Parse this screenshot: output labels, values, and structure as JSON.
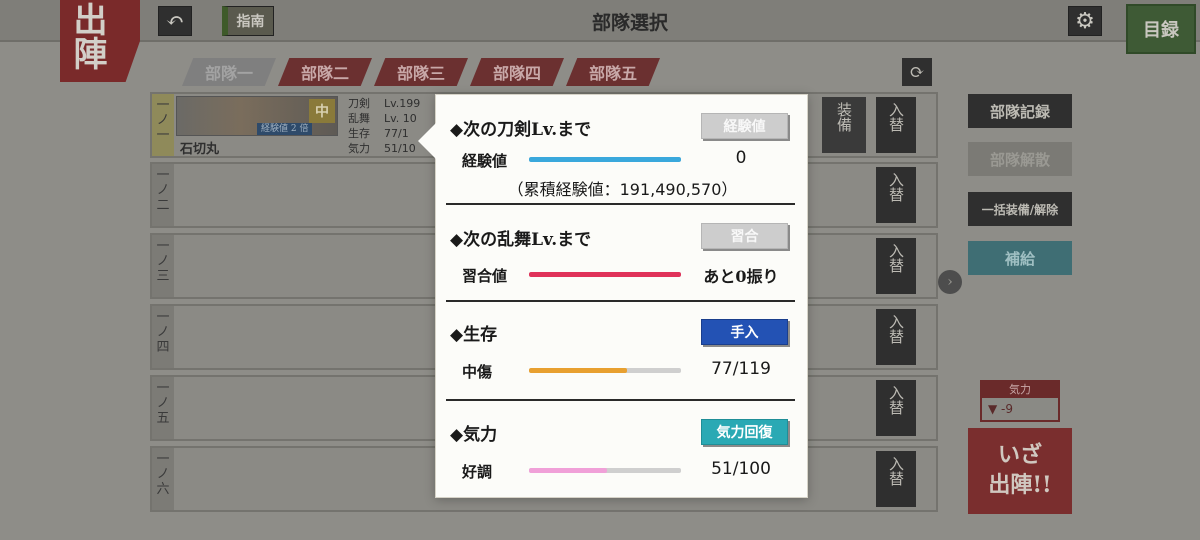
{
  "header": {
    "sortie_label": "出陣",
    "back_icon": "back-arrow-icon",
    "guide_label": "指南",
    "title": "部隊選択",
    "settings_icon": "gear-icon",
    "catalog_label": "目録"
  },
  "tabs": [
    "部隊一",
    "部隊二",
    "部隊三",
    "部隊四",
    "部隊五"
  ],
  "slots": [
    {
      "label": "一ノ一",
      "name": "石切丸",
      "rank": "中",
      "exp_badge": "経験値 2 倍",
      "stat_labels": [
        "刀剣",
        "乱舞",
        "生存",
        "気力"
      ],
      "stat_values": [
        "Lv.199",
        "Lv. 10",
        "77/1",
        "51/10"
      ],
      "equip_label": "装備",
      "swap_label": "入替"
    },
    {
      "label": "一ノ二",
      "swap_label": "入替"
    },
    {
      "label": "一ノ三",
      "swap_label": "入替"
    },
    {
      "label": "一ノ四",
      "swap_label": "入替"
    },
    {
      "label": "一ノ五",
      "swap_label": "入替"
    },
    {
      "label": "一ノ六",
      "swap_label": "入替"
    }
  ],
  "right_panel": {
    "record_label": "部隊記録",
    "disband_label": "部隊解散",
    "bulk_equip_label": "一括装備/解除",
    "supply_label": "補給",
    "morale_title": "気力",
    "morale_value": "▼ -9",
    "go_label_1": "いざ",
    "go_label_2": "出陣!!"
  },
  "popup": {
    "sword_level": {
      "title": "◆次の刀剣Lv.まで",
      "button": "経験値",
      "row_label": "経験値",
      "value": "0",
      "fill": 1.0,
      "color": "#3aa8dc",
      "total": "（累積経験値：191,490,570）"
    },
    "ranbu_level": {
      "title": "◆次の乱舞Lv.まで",
      "button": "習合",
      "row_label": "習合値",
      "value": "あと0振り",
      "fill": 1.0,
      "color": "#e0325a"
    },
    "survival": {
      "title": "◆生存",
      "button": "手入",
      "row_label": "中傷",
      "value": "77/119",
      "fill": 0.647,
      "color": "#e8a030"
    },
    "morale": {
      "title": "◆気力",
      "button": "気力回復",
      "row_label": "好調",
      "value": "51/100",
      "fill": 0.51,
      "color": "#f0a0d8"
    }
  }
}
